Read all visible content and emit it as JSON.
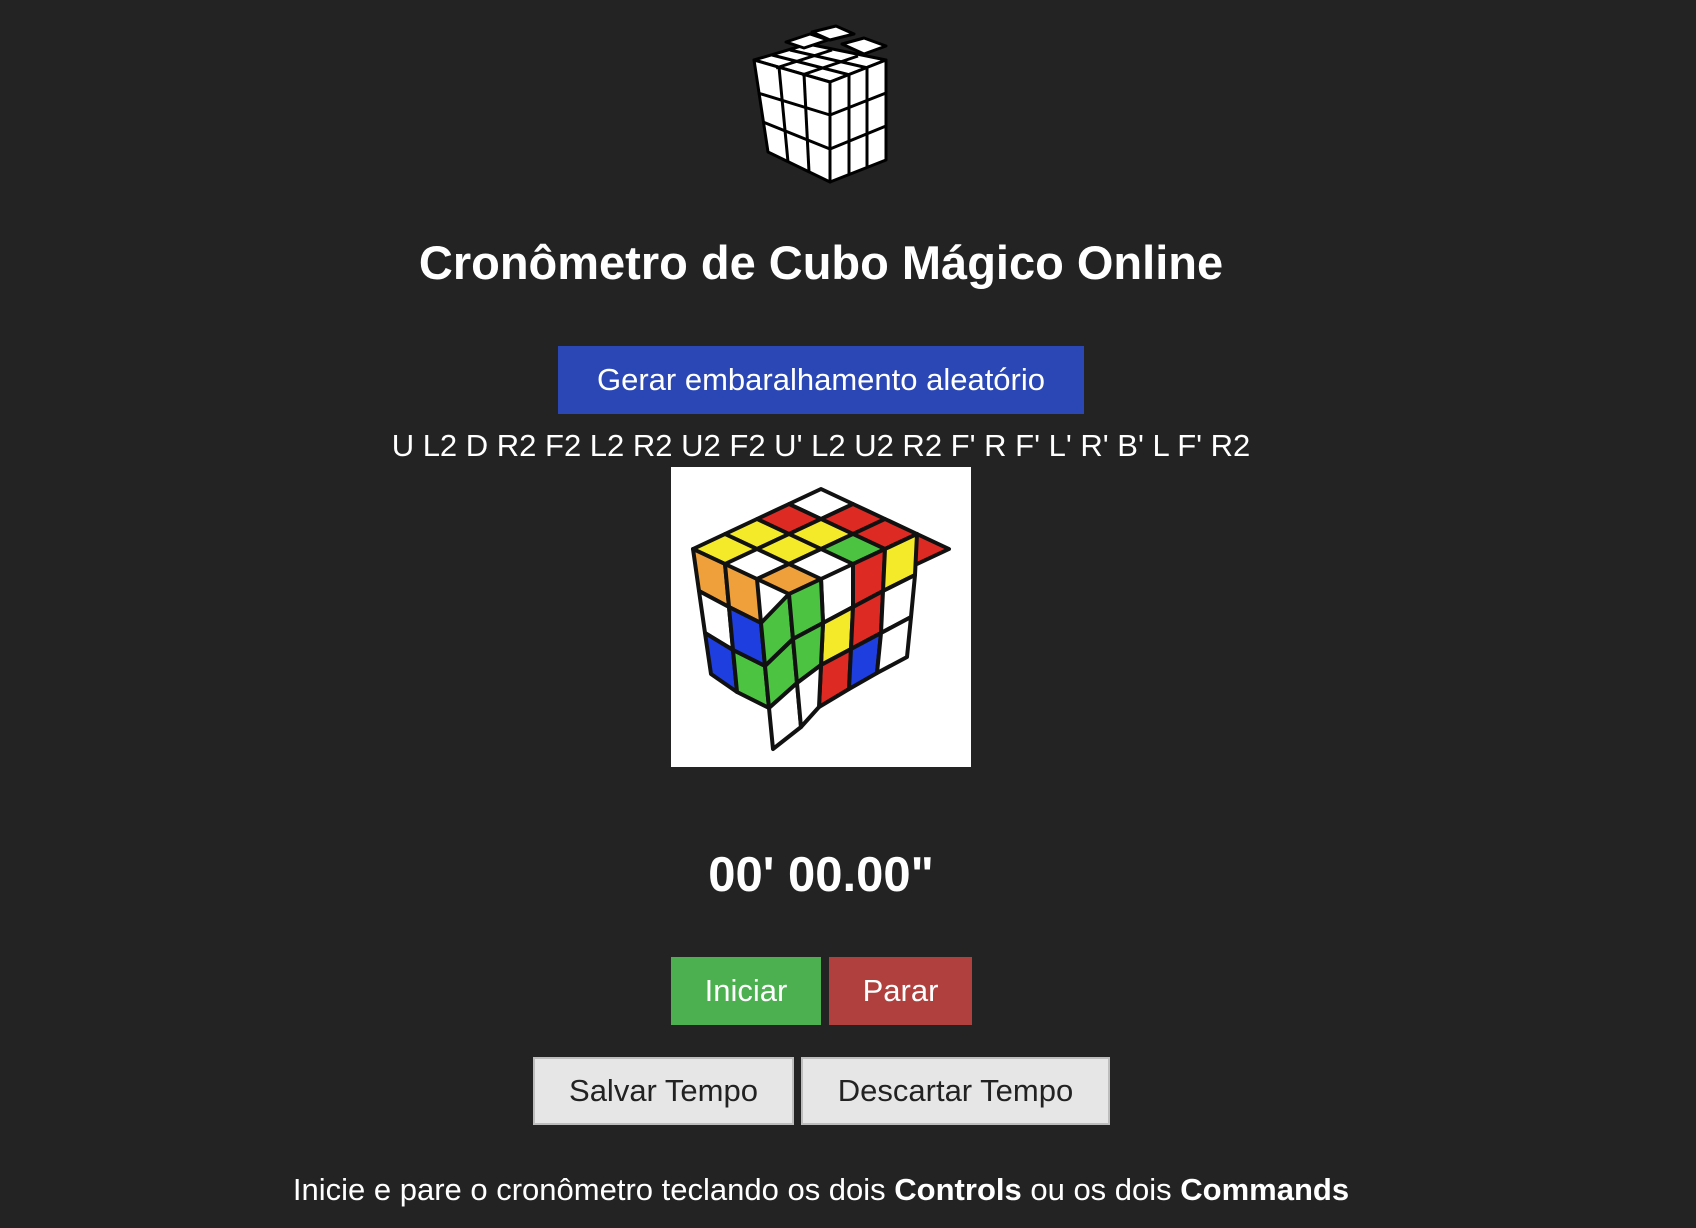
{
  "header": {
    "logo_icon": "rubiks-cube-outline-icon",
    "title": "Cronômetro de Cubo Mágico Online"
  },
  "scramble": {
    "button_label": "Gerar embaralhamento aleatório",
    "sequence": "U L2 D R2 F2 L2 R2 U2 F2 U' L2 U2 R2 F' R F' L' R' B' L F' R2",
    "preview_icon": "scrambled-cube-preview"
  },
  "timer": {
    "display": "00' 00.00\""
  },
  "controls": {
    "start_label": "Iniciar",
    "stop_label": "Parar",
    "save_label": "Salvar Tempo",
    "discard_label": "Descartar Tempo"
  },
  "hint": {
    "part1": "Inicie e pare o cronômetro teclando os dois ",
    "key1": "Controls",
    "part2": " ou os dois ",
    "key2": "Commands"
  },
  "colors": {
    "background": "#232323",
    "primary_button": "#2a47b5",
    "start_button": "#4caf50",
    "stop_button": "#b0403d",
    "neutral_button": "#e6e6e6"
  }
}
